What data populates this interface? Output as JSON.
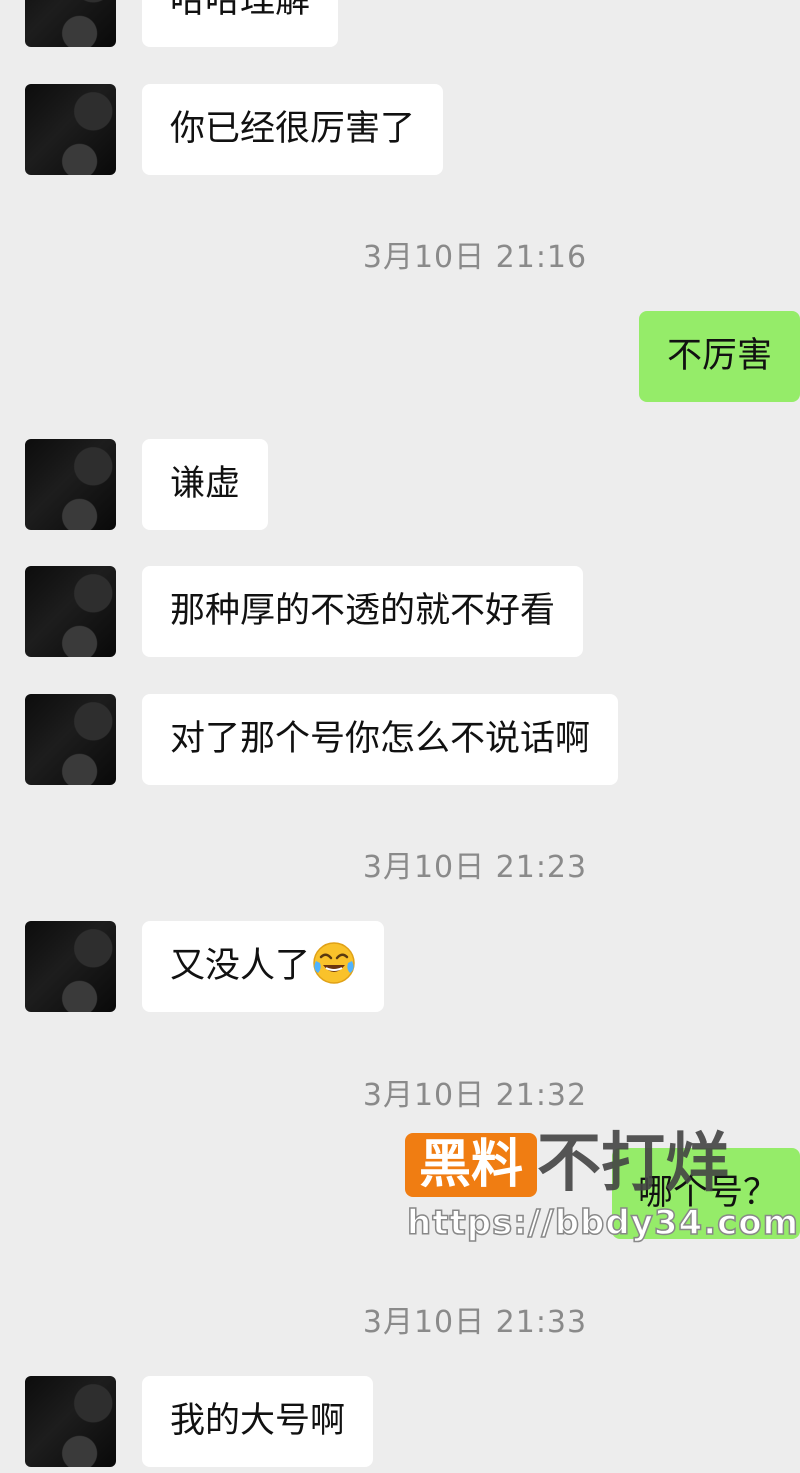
{
  "messages": [
    {
      "side": "left",
      "text": "哈哈理解"
    },
    {
      "side": "left",
      "text": "你已经很厉害了"
    },
    {
      "type": "time",
      "text": "3月10日 21:16"
    },
    {
      "side": "right",
      "text": "不厉害"
    },
    {
      "side": "left",
      "text": "谦虚"
    },
    {
      "side": "left",
      "text": "那种厚的不透的就不好看"
    },
    {
      "side": "left",
      "text": "对了那个号你怎么不说话啊"
    },
    {
      "type": "time",
      "text": "3月10日 21:23"
    },
    {
      "side": "left",
      "text": "又没人了",
      "emoji": "crying-laughing-emoji"
    },
    {
      "type": "time",
      "text": "3月10日 21:32"
    },
    {
      "side": "right",
      "text": "哪个号？"
    },
    {
      "type": "time",
      "text": "3月10日 21:33"
    },
    {
      "side": "left",
      "text": "我的大号啊"
    }
  ],
  "watermark": {
    "badge": "黑料",
    "title": "不打烊",
    "url": "https://bbdy34.com"
  },
  "colors": {
    "background": "#ededed",
    "incoming_bubble": "#ffffff",
    "outgoing_bubble": "#95ec69",
    "timestamp_text": "#8a8a8a",
    "watermark_badge": "#f07d12"
  }
}
